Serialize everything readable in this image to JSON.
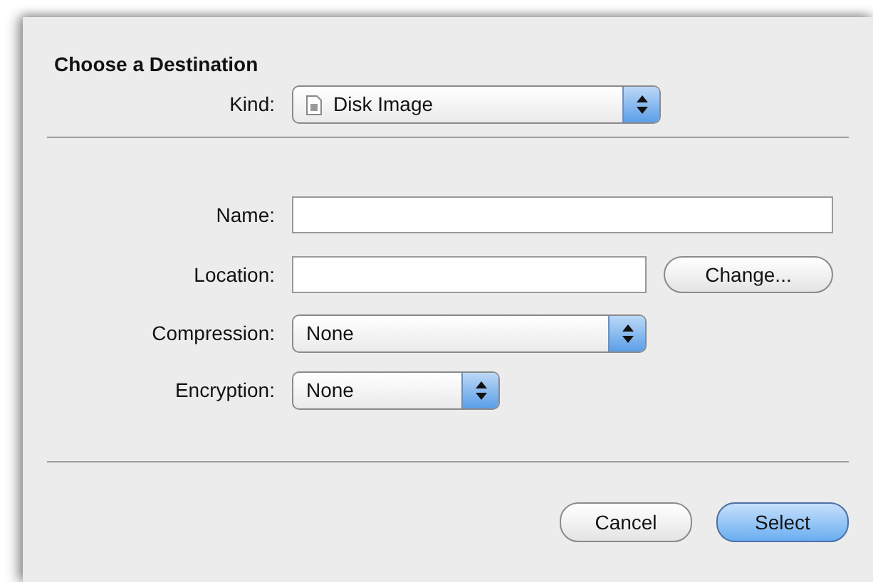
{
  "sheet": {
    "title": "Choose a Destination",
    "kind": {
      "label": "Kind:",
      "value": "Disk Image"
    },
    "fields": [
      {
        "kind": "text",
        "label": "Name:"
      },
      {
        "kind": "location",
        "label": "Location:",
        "button": "Change..."
      },
      {
        "kind": "popup",
        "label": "Compression:",
        "value": "None"
      },
      {
        "kind": "popup",
        "label": "Encryption:",
        "value": "None"
      }
    ],
    "buttons": [
      {
        "label": "Cancel",
        "default": false
      },
      {
        "label": "Select",
        "default": true
      }
    ]
  }
}
